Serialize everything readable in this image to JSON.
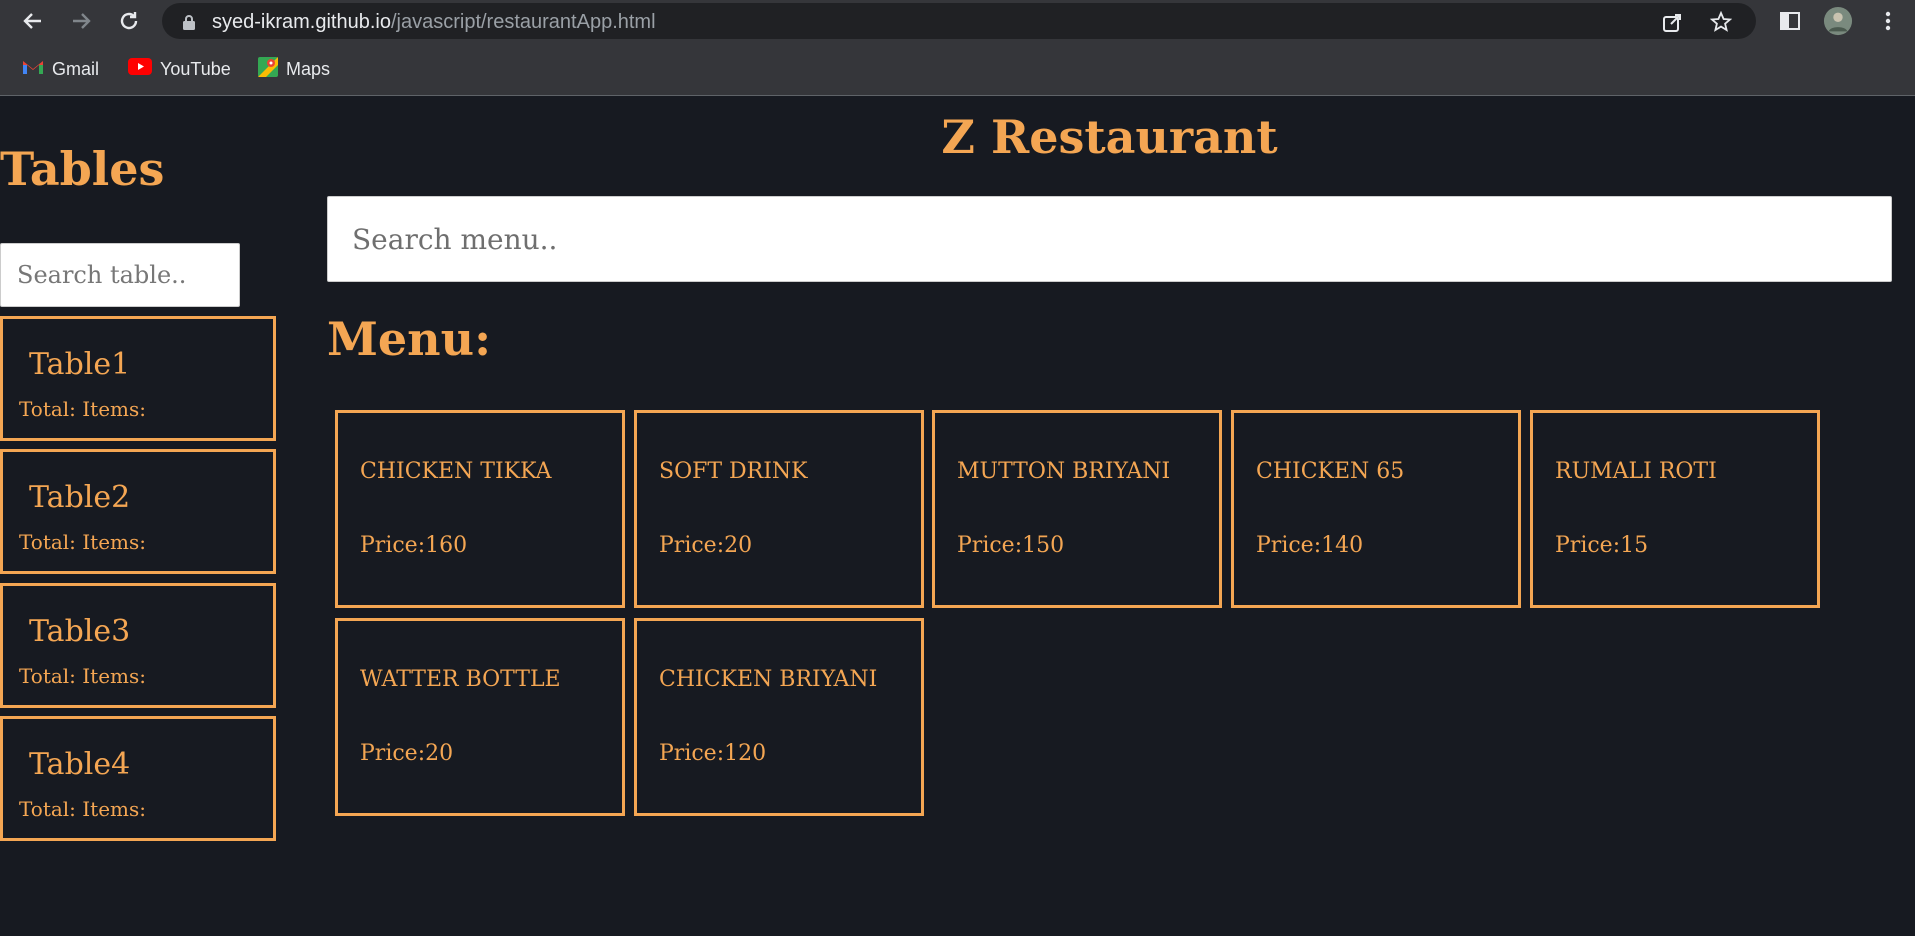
{
  "browser": {
    "url_host": "syed-ikram.github.io",
    "url_path": "/javascript/restaurantApp.html",
    "bookmarks": [
      "Gmail",
      "YouTube",
      "Maps"
    ]
  },
  "app": {
    "title": "Z Restaurant",
    "tables_title": "Tables",
    "table_search_placeholder": "Search table..",
    "menu_search_placeholder": "Search menu..",
    "menu_title": "Menu:",
    "accent_color": "#f4a653",
    "background_color": "#171a21"
  },
  "tables": [
    {
      "name": "Table1",
      "summary": "Total: Items:"
    },
    {
      "name": "Table2",
      "summary": "Total: Items:"
    },
    {
      "name": "Table3",
      "summary": "Total: Items:"
    },
    {
      "name": "Table4",
      "summary": "Total: Items:"
    }
  ],
  "menu": [
    {
      "name": "CHICKEN TIKKA",
      "price": "Price:160"
    },
    {
      "name": "SOFT DRINK",
      "price": "Price:20"
    },
    {
      "name": "MUTTON BRIYANI",
      "price": "Price:150"
    },
    {
      "name": "CHICKEN 65",
      "price": "Price:140"
    },
    {
      "name": "RUMALI ROTI",
      "price": "Price:15"
    },
    {
      "name": "WATTER BOTTLE",
      "price": "Price:20"
    },
    {
      "name": "CHICKEN BRIYANI",
      "price": "Price:120"
    }
  ]
}
